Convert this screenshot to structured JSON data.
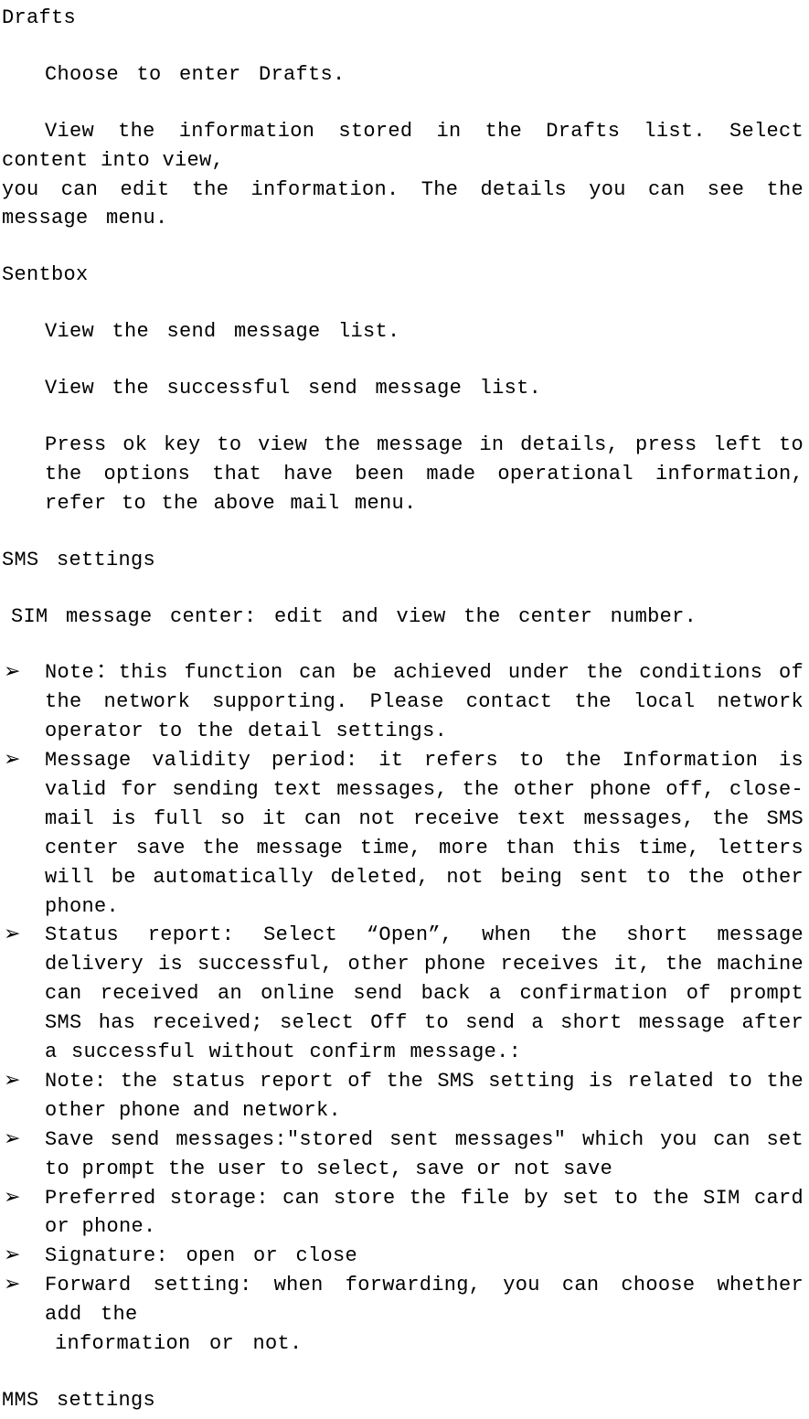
{
  "sections": {
    "drafts": {
      "heading": "Drafts",
      "p1": "Choose to enter Drafts.",
      "p2_firstline": "View the information stored in the Drafts list. Select content into view,",
      "p2_rest": "you can edit the information. The details you can see the message menu."
    },
    "sentbox": {
      "heading": "Sentbox",
      "p1": "View the send message list.",
      "p2": "View the successful send message list.",
      "p3": "Press ok key to view the message in details, press left to the options that have been made operational information, refer to the above mail menu."
    },
    "sms": {
      "heading": "SMS settings",
      "intro": "SIM message center: edit and view the center number.",
      "bullets": [
        "Note：this function can be achieved under the conditions of the network supporting. Please contact the local network operator to the detail settings.",
        "Message validity period: it refers to the Information is valid for sending  text messages, the other phone off, close-mail is full so it can not receive text messages, the SMS center save the message time, more than this time, letters will be automatically deleted, not being sent to the other phone.",
        "Status report: Select “Open”, when the short message delivery is successful, other phone receives it, the machine can received an online send back a confirmation of prompt SMS has received; select Off to send a short message after a successful without confirm message.:",
        "Note: the status report of the SMS setting is related to the other phone and network.",
        "Save send messages:\"stored sent messages\" which you can set to prompt the user to select, save or not save",
        "Preferred storage: can store the file by set to the SIM card or phone.",
        "Signature: open or close",
        "Forward setting:  when forwarding, you can choose whether add the"
      ],
      "bullet8_line2": "information or not."
    },
    "mms": {
      "heading": "MMS settings"
    }
  },
  "marker": "➢"
}
